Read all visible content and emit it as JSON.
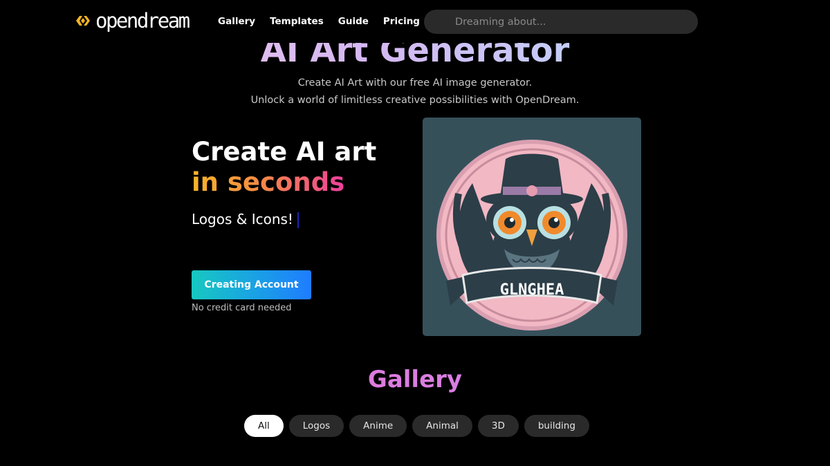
{
  "header": {
    "logo_text": "opendream",
    "nav": [
      {
        "label": "Gallery"
      },
      {
        "label": "Templates"
      },
      {
        "label": "Guide"
      },
      {
        "label": "Pricing"
      }
    ],
    "search": {
      "placeholder": "Dreaming about...",
      "value": ""
    }
  },
  "hero": {
    "title": "AI Art Generator",
    "subtitle_line1": "Create AI Art with our free AI image generator.",
    "subtitle_line2": "Unlock a world of limitless creative possibilities with OpenDream."
  },
  "create": {
    "title_line1": "Create AI art",
    "title_line2": "in seconds",
    "typing_text": "Logos & Icons!",
    "cta_label": "Creating Account",
    "note": "No credit card needed"
  },
  "showcase_image": {
    "subject": "owl-logo",
    "banner_text": "GLNGHEA"
  },
  "gallery": {
    "title": "Gallery",
    "filters": [
      {
        "label": "All",
        "active": true
      },
      {
        "label": "Logos",
        "active": false
      },
      {
        "label": "Anime",
        "active": false
      },
      {
        "label": "Animal",
        "active": false
      },
      {
        "label": "3D",
        "active": false
      },
      {
        "label": "building",
        "active": false
      }
    ]
  },
  "colors": {
    "background": "#000000",
    "logo_accent": "#f5b324",
    "cta_gradient_start": "#17c8c0",
    "cta_gradient_end": "#1f7cff",
    "chip_bg": "#2a2a2a",
    "image_bg": "#36505a"
  }
}
